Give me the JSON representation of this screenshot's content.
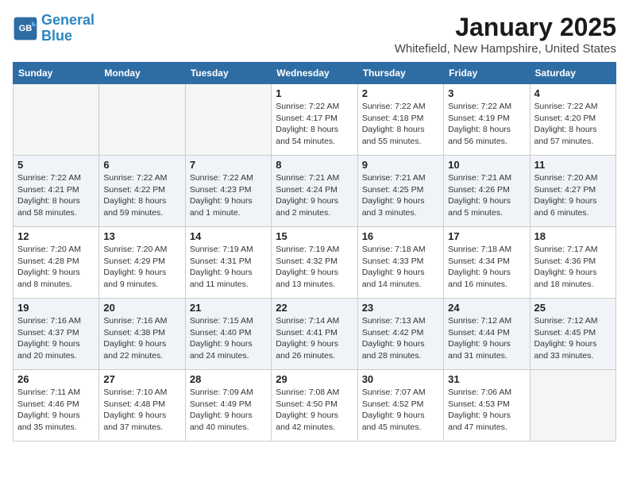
{
  "header": {
    "logo_line1": "General",
    "logo_line2": "Blue",
    "month": "January 2025",
    "location": "Whitefield, New Hampshire, United States"
  },
  "days_of_week": [
    "Sunday",
    "Monday",
    "Tuesday",
    "Wednesday",
    "Thursday",
    "Friday",
    "Saturday"
  ],
  "weeks": [
    [
      {
        "day": "",
        "info": ""
      },
      {
        "day": "",
        "info": ""
      },
      {
        "day": "",
        "info": ""
      },
      {
        "day": "1",
        "info": "Sunrise: 7:22 AM\nSunset: 4:17 PM\nDaylight: 8 hours\nand 54 minutes."
      },
      {
        "day": "2",
        "info": "Sunrise: 7:22 AM\nSunset: 4:18 PM\nDaylight: 8 hours\nand 55 minutes."
      },
      {
        "day": "3",
        "info": "Sunrise: 7:22 AM\nSunset: 4:19 PM\nDaylight: 8 hours\nand 56 minutes."
      },
      {
        "day": "4",
        "info": "Sunrise: 7:22 AM\nSunset: 4:20 PM\nDaylight: 8 hours\nand 57 minutes."
      }
    ],
    [
      {
        "day": "5",
        "info": "Sunrise: 7:22 AM\nSunset: 4:21 PM\nDaylight: 8 hours\nand 58 minutes."
      },
      {
        "day": "6",
        "info": "Sunrise: 7:22 AM\nSunset: 4:22 PM\nDaylight: 8 hours\nand 59 minutes."
      },
      {
        "day": "7",
        "info": "Sunrise: 7:22 AM\nSunset: 4:23 PM\nDaylight: 9 hours\nand 1 minute."
      },
      {
        "day": "8",
        "info": "Sunrise: 7:21 AM\nSunset: 4:24 PM\nDaylight: 9 hours\nand 2 minutes."
      },
      {
        "day": "9",
        "info": "Sunrise: 7:21 AM\nSunset: 4:25 PM\nDaylight: 9 hours\nand 3 minutes."
      },
      {
        "day": "10",
        "info": "Sunrise: 7:21 AM\nSunset: 4:26 PM\nDaylight: 9 hours\nand 5 minutes."
      },
      {
        "day": "11",
        "info": "Sunrise: 7:20 AM\nSunset: 4:27 PM\nDaylight: 9 hours\nand 6 minutes."
      }
    ],
    [
      {
        "day": "12",
        "info": "Sunrise: 7:20 AM\nSunset: 4:28 PM\nDaylight: 9 hours\nand 8 minutes."
      },
      {
        "day": "13",
        "info": "Sunrise: 7:20 AM\nSunset: 4:29 PM\nDaylight: 9 hours\nand 9 minutes."
      },
      {
        "day": "14",
        "info": "Sunrise: 7:19 AM\nSunset: 4:31 PM\nDaylight: 9 hours\nand 11 minutes."
      },
      {
        "day": "15",
        "info": "Sunrise: 7:19 AM\nSunset: 4:32 PM\nDaylight: 9 hours\nand 13 minutes."
      },
      {
        "day": "16",
        "info": "Sunrise: 7:18 AM\nSunset: 4:33 PM\nDaylight: 9 hours\nand 14 minutes."
      },
      {
        "day": "17",
        "info": "Sunrise: 7:18 AM\nSunset: 4:34 PM\nDaylight: 9 hours\nand 16 minutes."
      },
      {
        "day": "18",
        "info": "Sunrise: 7:17 AM\nSunset: 4:36 PM\nDaylight: 9 hours\nand 18 minutes."
      }
    ],
    [
      {
        "day": "19",
        "info": "Sunrise: 7:16 AM\nSunset: 4:37 PM\nDaylight: 9 hours\nand 20 minutes."
      },
      {
        "day": "20",
        "info": "Sunrise: 7:16 AM\nSunset: 4:38 PM\nDaylight: 9 hours\nand 22 minutes."
      },
      {
        "day": "21",
        "info": "Sunrise: 7:15 AM\nSunset: 4:40 PM\nDaylight: 9 hours\nand 24 minutes."
      },
      {
        "day": "22",
        "info": "Sunrise: 7:14 AM\nSunset: 4:41 PM\nDaylight: 9 hours\nand 26 minutes."
      },
      {
        "day": "23",
        "info": "Sunrise: 7:13 AM\nSunset: 4:42 PM\nDaylight: 9 hours\nand 28 minutes."
      },
      {
        "day": "24",
        "info": "Sunrise: 7:12 AM\nSunset: 4:44 PM\nDaylight: 9 hours\nand 31 minutes."
      },
      {
        "day": "25",
        "info": "Sunrise: 7:12 AM\nSunset: 4:45 PM\nDaylight: 9 hours\nand 33 minutes."
      }
    ],
    [
      {
        "day": "26",
        "info": "Sunrise: 7:11 AM\nSunset: 4:46 PM\nDaylight: 9 hours\nand 35 minutes."
      },
      {
        "day": "27",
        "info": "Sunrise: 7:10 AM\nSunset: 4:48 PM\nDaylight: 9 hours\nand 37 minutes."
      },
      {
        "day": "28",
        "info": "Sunrise: 7:09 AM\nSunset: 4:49 PM\nDaylight: 9 hours\nand 40 minutes."
      },
      {
        "day": "29",
        "info": "Sunrise: 7:08 AM\nSunset: 4:50 PM\nDaylight: 9 hours\nand 42 minutes."
      },
      {
        "day": "30",
        "info": "Sunrise: 7:07 AM\nSunset: 4:52 PM\nDaylight: 9 hours\nand 45 minutes."
      },
      {
        "day": "31",
        "info": "Sunrise: 7:06 AM\nSunset: 4:53 PM\nDaylight: 9 hours\nand 47 minutes."
      },
      {
        "day": "",
        "info": ""
      }
    ]
  ]
}
